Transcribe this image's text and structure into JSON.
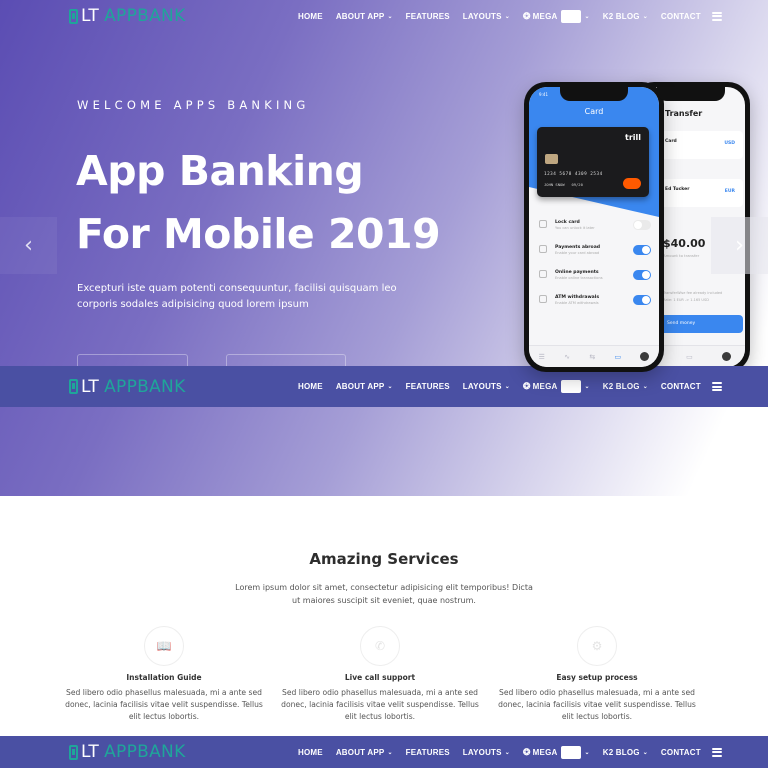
{
  "brand": {
    "logo_prefix": "LT",
    "logo_name": "APPBANK",
    "accent_color": "#1fa59a",
    "nav_bg_color": "#4a50a3"
  },
  "nav": {
    "items": [
      {
        "label": "HOME",
        "has_caret": false
      },
      {
        "label": "ABOUT APP",
        "has_caret": true
      },
      {
        "label": "FEATURES",
        "has_caret": false
      },
      {
        "label": "LAYOUTS",
        "has_caret": true
      },
      {
        "label": "MEGA",
        "has_caret": true,
        "icon": "gear-icon"
      },
      {
        "label": "K2 BLOG",
        "has_caret": true
      },
      {
        "label": "CONTACT",
        "has_caret": false
      }
    ],
    "caret_glyph": "⌄",
    "mega_icon_glyph": "❂",
    "menu_icon": "hamburger-icon"
  },
  "hero": {
    "eyebrow": "WELCOME APPS BANKING",
    "headline_line1": "App Banking",
    "headline_line2": "For Mobile 2019",
    "lead": "Excepturi iste quam potenti consequuntur, facilisi quisquam leo corporis sodales adipisicing quod lorem ipsum",
    "prev_arrow": "‹",
    "next_arrow": "›"
  },
  "phone_front": {
    "status_time": "9:41",
    "title": "Card",
    "card": {
      "brand": "trill",
      "number": "1234 5678 4309 2534",
      "holder": "JOHN SNOW",
      "expiry": "09/20"
    },
    "settings": [
      {
        "title": "Lock card",
        "subtitle": "You can unlock it later",
        "enabled": false
      },
      {
        "title": "Payments abroad",
        "subtitle": "Enable your card abroad",
        "enabled": true
      },
      {
        "title": "Online payments",
        "subtitle": "Enable online transactions",
        "enabled": true
      },
      {
        "title": "ATM withdrawals",
        "subtitle": "Enable ATM withdrawals",
        "enabled": true
      }
    ]
  },
  "phone_back": {
    "title": "Transfer",
    "from_label": "Card",
    "from_currency": "USD",
    "to_label": "Ed Tucker",
    "to_currency": "EUR",
    "amount": "$40.00",
    "amount_sub": "Amount to transfer",
    "fee_line1": "TransferWise fee already included",
    "fee_line2": "Rate: 1 EUR -> 1.165 USD",
    "send_label": "Send money"
  },
  "services": {
    "title": "Amazing Services",
    "description": "Lorem ipsum dolor sit amet, consectetur adipisicing elit temporibus! Dicta ut maiores suscipit sit eveniet, quae nostrum.",
    "items": [
      {
        "title": "Installation Guide",
        "icon": "book-icon",
        "glyph": "📖",
        "text": "Sed libero odio phasellus malesuada, mi a ante sed donec, lacinia facilisis vitae velit suspendisse. Tellus elit lectus lobortis."
      },
      {
        "title": "Live call support",
        "icon": "phone-icon",
        "glyph": "✆",
        "text": "Sed libero odio phasellus malesuada, mi a ante sed donec, lacinia facilisis vitae velit suspendisse. Tellus elit lectus lobortis."
      },
      {
        "title": "Easy setup process",
        "icon": "gear-icon",
        "glyph": "⚙",
        "text": "Sed libero odio phasellus malesuada, mi a ante sed donec, lacinia facilisis vitae velit suspendisse. Tellus elit lectus lobortis."
      }
    ]
  }
}
